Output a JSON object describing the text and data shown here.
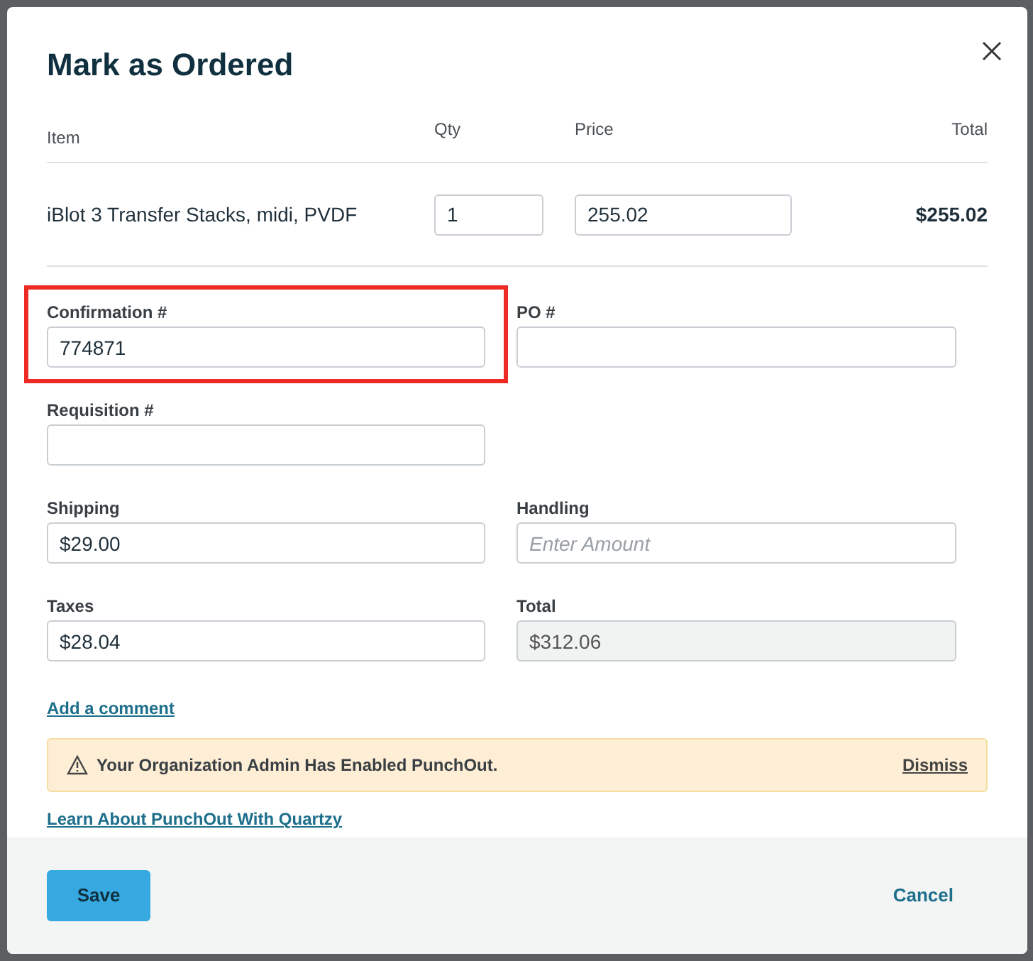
{
  "dialog": {
    "title": "Mark as Ordered"
  },
  "table": {
    "columns": [
      "Item",
      "Qty",
      "Price",
      "Total"
    ],
    "rows": [
      {
        "item": "iBlot 3 Transfer Stacks, midi, PVDF",
        "qty": "1",
        "price": "255.02",
        "total": "$255.02"
      }
    ]
  },
  "fields": [
    {
      "label": "Confirmation #",
      "value": "774871",
      "highlighted": true,
      "disabled": false
    },
    {
      "label": "PO #",
      "highlighted": false,
      "disabled": false
    },
    {
      "label": "Requisition #",
      "highlighted": false,
      "disabled": false
    },
    {
      "kind": "spacer"
    },
    {
      "label": "Shipping",
      "value": "$29.00",
      "highlighted": false,
      "disabled": false
    },
    {
      "label": "Handling",
      "placeholder": "Enter Amount",
      "highlighted": false,
      "disabled": false
    },
    {
      "label": "Taxes",
      "value": "$28.04",
      "highlighted": false,
      "disabled": false
    },
    {
      "label": "Total",
      "value": "$312.06",
      "highlighted": false,
      "disabled": true
    }
  ],
  "comment_link": "Add a comment",
  "alert": {
    "message": "Your Organization Admin Has Enabled PunchOut.",
    "action": "Dismiss"
  },
  "learn_link": "Learn About PunchOut With Quartzy",
  "footer": {
    "primary": "Save",
    "secondary": "Cancel"
  }
}
